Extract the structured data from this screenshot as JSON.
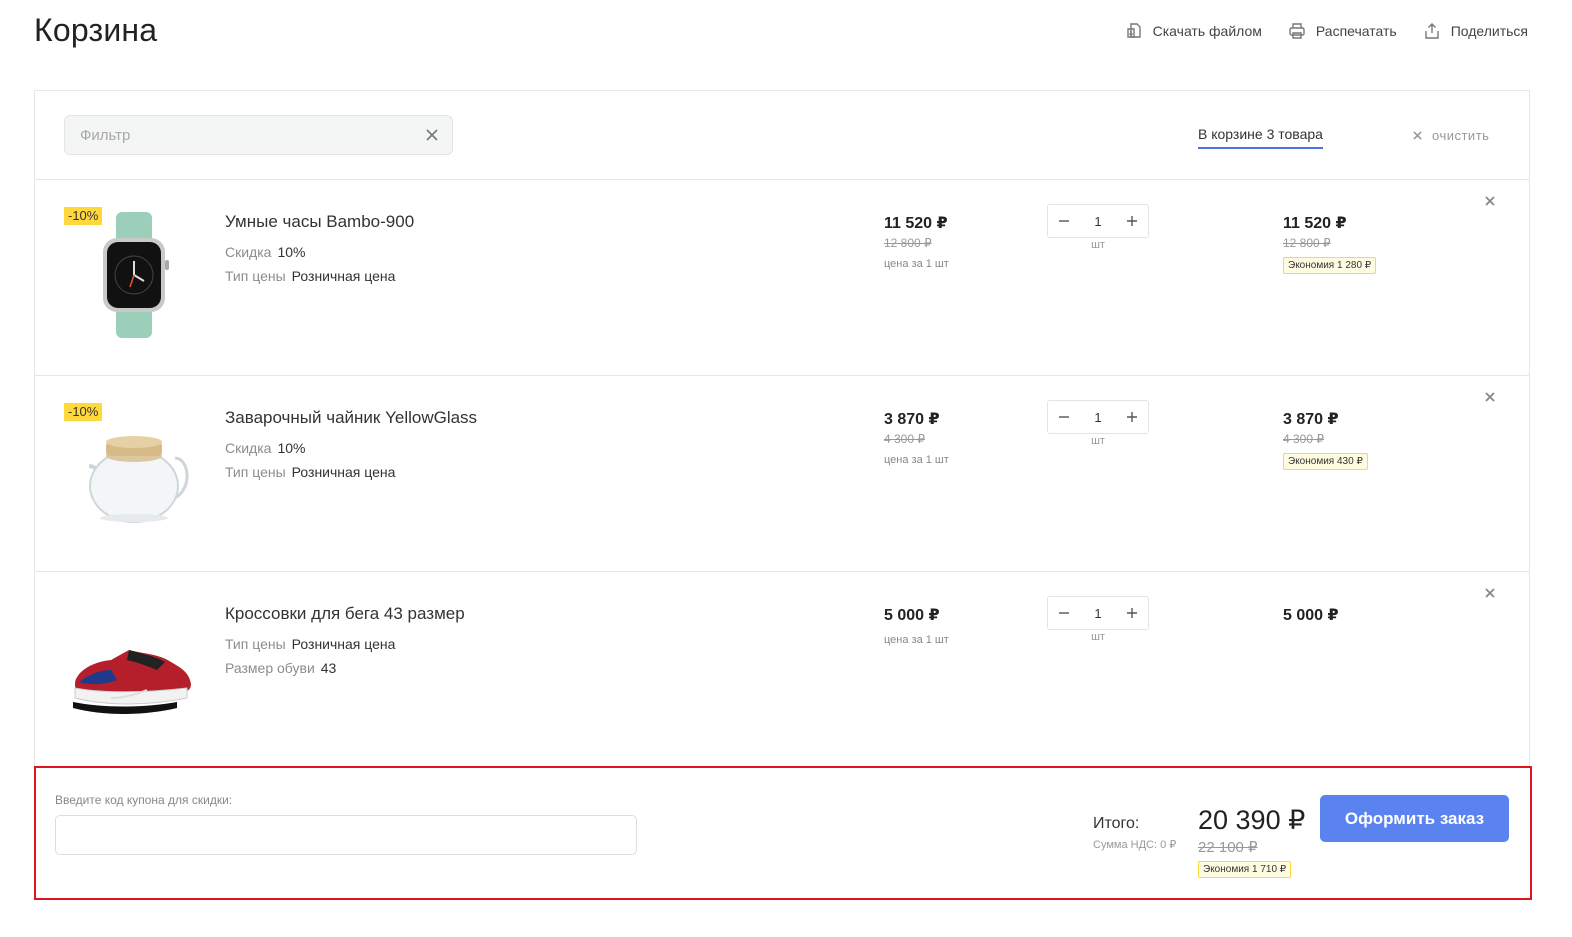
{
  "page": {
    "title": "Корзина"
  },
  "actions": {
    "download": "Скачать файлом",
    "print": "Распечатать",
    "share": "Поделиться"
  },
  "filter": {
    "placeholder": "Фильтр"
  },
  "cart": {
    "count_label": "В корзине 3 товара",
    "clear_label": "очистить"
  },
  "items": [
    {
      "badge": "-10%",
      "name": "Умные часы Bambo-900",
      "props": [
        {
          "key": "Скидка",
          "value": "10%"
        },
        {
          "key": "Тип цены",
          "value": "Розничная цена"
        }
      ],
      "price": "11 520 ₽",
      "price_old": "12 800 ₽",
      "price_unit": "цена за 1 шт",
      "qty": "1",
      "qty_unit": "шт",
      "total": "11 520 ₽",
      "total_old": "12 800 ₽",
      "saving": "Экономия  1 280 ₽"
    },
    {
      "badge": "-10%",
      "name": "Заварочный чайник YellowGlass",
      "props": [
        {
          "key": "Скидка",
          "value": "10%"
        },
        {
          "key": "Тип цены",
          "value": "Розничная цена"
        }
      ],
      "price": "3 870 ₽",
      "price_old": "4 300 ₽",
      "price_unit": "цена за 1 шт",
      "qty": "1",
      "qty_unit": "шт",
      "total": "3 870 ₽",
      "total_old": "4 300 ₽",
      "saving": "Экономия  430 ₽"
    },
    {
      "name": "Кроссовки для бега 43 размер",
      "props": [
        {
          "key": "Тип цены",
          "value": "Розничная цена"
        },
        {
          "key": "Размер обуви",
          "value": "43"
        }
      ],
      "price": "5 000 ₽",
      "price_unit": "цена за 1 шт",
      "qty": "1",
      "qty_unit": "шт",
      "total": "5 000 ₽"
    }
  ],
  "summary": {
    "coupon_label": "Введите код купона для скидки:",
    "total_label": "Итого:",
    "vat_label": "Сумма НДС: 0 ₽",
    "total_value": "20 390 ₽",
    "total_old": "22 100 ₽",
    "saving": "Экономия  1 710 ₽",
    "checkout_label": "Оформить заказ"
  },
  "colors": {
    "accent": "#5a83f0",
    "badge": "#ffd83b",
    "highlight_border": "#e0141e",
    "underline": "#4b73e6"
  },
  "icons": {
    "download": "download-file-icon",
    "print": "printer-icon",
    "share": "share-icon",
    "clear": "close-icon",
    "minus": "minus-icon",
    "plus": "plus-icon"
  }
}
